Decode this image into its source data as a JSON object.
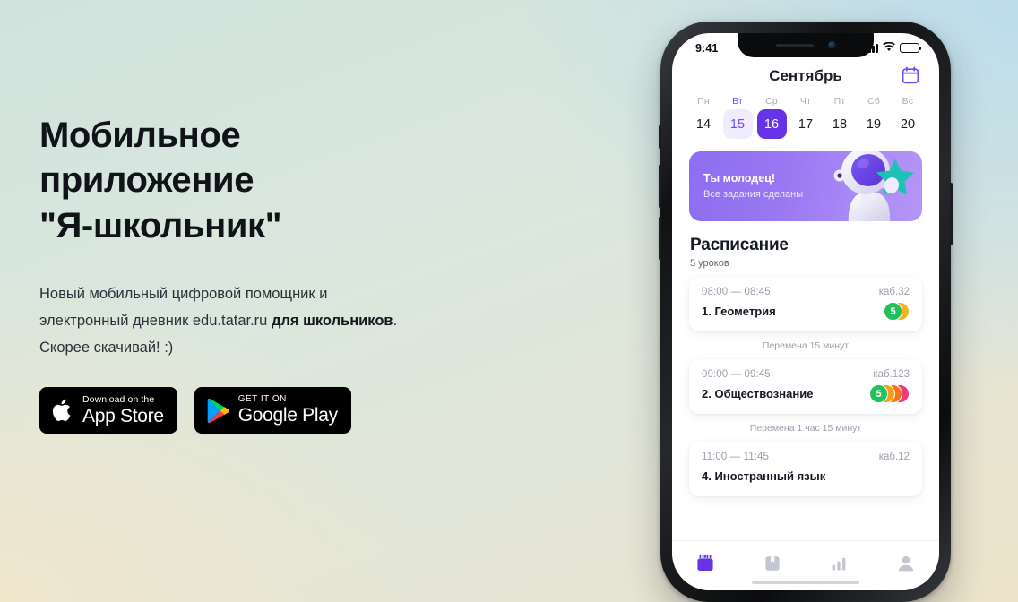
{
  "hero": {
    "headline_lines": [
      "Мобильное",
      "приложение",
      "\"Я-школьник\""
    ],
    "sub_line1": "Новый мобильный цифровой помощник и",
    "sub_line2_prefix": "электронный дневник edu.tatar.ru ",
    "sub_line2_bold": "для школьников",
    "sub_line2_suffix": ".",
    "sub_line3": "Скорее скачивай! :)"
  },
  "badges": {
    "appstore": {
      "top": "Download on the",
      "bottom": "App Store",
      "icon": "apple-icon"
    },
    "googleplay": {
      "top": "GET IT ON",
      "bottom": "Google Play",
      "icon": "google-play-icon"
    }
  },
  "phone": {
    "status": {
      "time": "9:41",
      "signal_icon": "cellular-signal-icon",
      "wifi_icon": "wifi-icon",
      "battery_icon": "battery-icon"
    },
    "calendar": {
      "month": "Сентябрь",
      "icon": "calendar-icon",
      "weekdays": [
        "Пн",
        "Вт",
        "Ср",
        "Чт",
        "Пт",
        "Сб",
        "Вс"
      ],
      "selected_weekday_index": 1,
      "dates": [
        "14",
        "15",
        "16",
        "17",
        "18",
        "19",
        "20"
      ],
      "soft_index": 1,
      "active_index": 2
    },
    "promo": {
      "title": "Ты молодец!",
      "subtitle": "Все задания сделаны",
      "art": "astronaut-with-star-illustration"
    },
    "schedule": {
      "title": "Расписание",
      "count": "5 уроков",
      "items": [
        {
          "kind": "lesson",
          "time": "08:00 — 08:45",
          "room": "каб.32",
          "name": "1. Геометрия",
          "grades": [
            {
              "value": "5",
              "color": "#22c15e"
            },
            {
              "value": "",
              "color": "#f5b323"
            }
          ]
        },
        {
          "kind": "break",
          "text": "Перемена 15 минут"
        },
        {
          "kind": "lesson",
          "time": "09:00 — 09:45",
          "room": "каб.123",
          "name": "2. Обществознание",
          "grades": [
            {
              "value": "5",
              "color": "#22c15e"
            },
            {
              "value": "",
              "color": "#f59f1b"
            },
            {
              "value": "",
              "color": "#f4741f"
            },
            {
              "value": "",
              "color": "#ef3b7a"
            }
          ]
        },
        {
          "kind": "break",
          "text": "Перемена 1 час 15 минут"
        },
        {
          "kind": "lesson",
          "time": "11:00 — 11:45",
          "room": "каб.12",
          "name": "4. Иностранный язык",
          "grades": []
        }
      ]
    },
    "tabs": [
      {
        "icon": "calendar-tab-icon",
        "active": true
      },
      {
        "icon": "book-tab-icon",
        "active": false
      },
      {
        "icon": "stats-bars-tab-icon",
        "active": false
      },
      {
        "icon": "profile-tab-icon",
        "active": false
      }
    ]
  },
  "colors": {
    "accent_purple": "#6633e6",
    "accent_soft": "#f0ecfe",
    "promo_gradient_from": "#8e6ef0",
    "promo_gradient_to": "#b495f7",
    "star_teal": "#1ec2b4",
    "grade_green": "#22c15e"
  }
}
